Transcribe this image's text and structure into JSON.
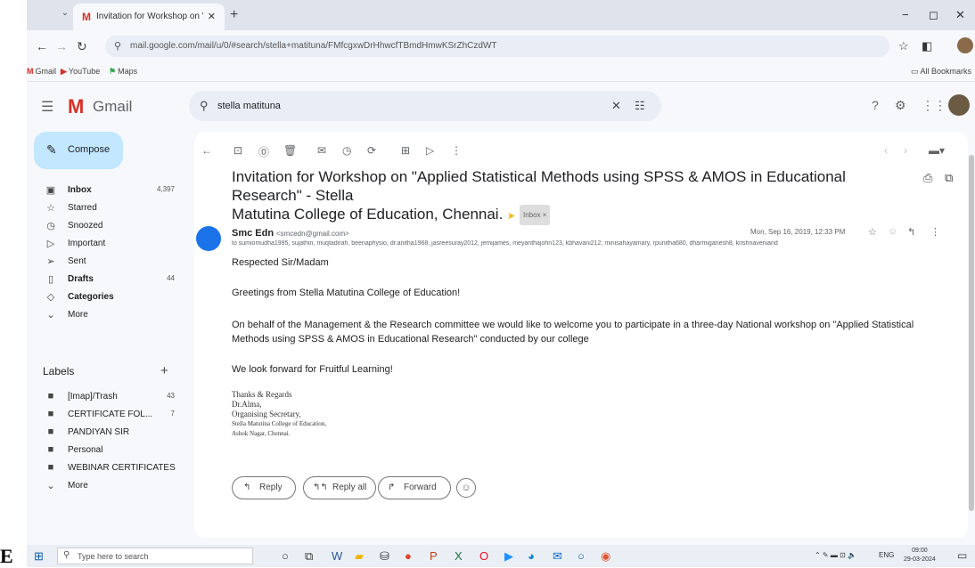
{
  "browser": {
    "tab_title": "Invitation for Workshop on \"Ap",
    "url": "mail.google.com/mail/u/0/#search/stella+matituna/FMfcgxwDrHhwcfTBmdHmwKSrZhCzdWT",
    "bookmarks": [
      "Gmail",
      "YouTube",
      "Maps"
    ],
    "all_bookmarks": "All Bookmarks"
  },
  "gmail": {
    "brand": "Gmail",
    "search_value": "stella matituna",
    "compose": "Compose",
    "nav": [
      {
        "label": "Inbox",
        "count": "4,397",
        "icon": "inbox-icon"
      },
      {
        "label": "Starred",
        "count": "",
        "icon": "star-icon"
      },
      {
        "label": "Snoozed",
        "count": "",
        "icon": "clock-icon"
      },
      {
        "label": "Important",
        "count": "",
        "icon": "important-icon"
      },
      {
        "label": "Sent",
        "count": "",
        "icon": "send-icon"
      },
      {
        "label": "Drafts",
        "count": "44",
        "icon": "draft-icon"
      },
      {
        "label": "Categories",
        "count": "",
        "icon": "label-icon"
      },
      {
        "label": "More",
        "count": "",
        "icon": "chevron-down-icon"
      }
    ],
    "labels_title": "Labels",
    "labels": [
      {
        "label": "[Imap]/Trash",
        "count": "43"
      },
      {
        "label": "CERTIFICATE FOL...",
        "count": "7"
      },
      {
        "label": "PANDIYAN SIR",
        "count": ""
      },
      {
        "label": "Personal",
        "count": ""
      },
      {
        "label": "WEBINAR CERTIFICATES",
        "count": ""
      },
      {
        "label": "More",
        "count": ""
      }
    ]
  },
  "email": {
    "subject_line1": "Invitation for Workshop on \"Applied Statistical Methods using SPSS & AMOS in Educational Research\" - Stella",
    "subject_line2": "Matutina College of Education, Chennai.",
    "inbox_chip": "Inbox ×",
    "sender_name": "Smc Edn",
    "sender_email": "<smcedn@gmail.com>",
    "to": "to sumiomudha1995, sujathin, muqtadirah, beenaphysio, dr.anitha1968, jasreesuray2012, jemijames, meyanthajohn123, kbhavani212, minisahayamary, rpunitha680, dharmiganesh8, krishnaveniand",
    "date": "Mon, Sep 16, 2019, 12:33 PM",
    "greeting": "Respected Sir/Madam",
    "para1": "Greetings from Stella Matutina College of Education!",
    "para2_line1": "On behalf of the Management & the Research committee we would like to welcome you to participate  in a three-day  National workshop on \"Applied Statistical",
    "para2_line2": "Methods using SPSS & AMOS in Educational Research\" conducted by our college",
    "para3": "We look forward for Fruitful Learning!",
    "signature": [
      "Thanks & Regards",
      "Dr.Alma,",
      "Organising Secretary,",
      "Stella Matutina College of Education,",
      "Ashok Nagar, Chennai."
    ],
    "reply": "Reply",
    "reply_all": "Reply all",
    "forward": "Forward"
  },
  "taskbar": {
    "search_placeholder": "Type here to search",
    "lang": "ENG",
    "time": "09:00",
    "date": "29-03-2024"
  },
  "page_letter": "E"
}
